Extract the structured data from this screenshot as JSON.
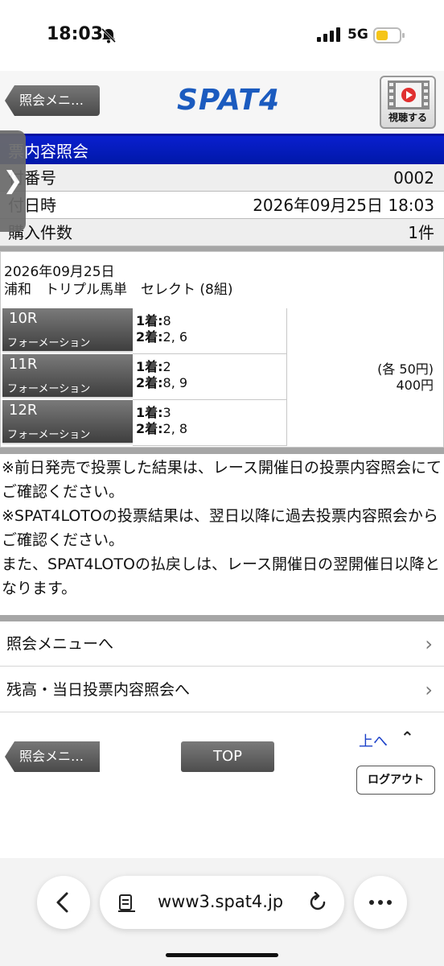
{
  "status": {
    "time": "18:03",
    "network": "5G"
  },
  "header": {
    "back_menu": "照会メニ…",
    "logo": "SPAT4",
    "watch_label": "視聴する"
  },
  "info": {
    "title": "票内容照会",
    "rows": [
      {
        "label": "付番号",
        "value": "0002"
      },
      {
        "label": "付日時",
        "value": "2026年09月25日  18:03"
      },
      {
        "label": "購入件数",
        "value": "1件"
      }
    ]
  },
  "bet": {
    "date": "2026年09月25日",
    "type": "浦和　トリプル馬単　セレクト (8組)",
    "races": [
      {
        "race": "10R",
        "method": "フォーメーション",
        "first_label": "1着:",
        "first": "8",
        "second_label": "2着:",
        "second": "2, 6"
      },
      {
        "race": "11R",
        "method": "フォーメーション",
        "first_label": "1着:",
        "first": "2",
        "second_label": "2着:",
        "second": "8, 9"
      },
      {
        "race": "12R",
        "method": "フォーメーション",
        "first_label": "1着:",
        "first": "3",
        "second_label": "2着:",
        "second": "2, 8"
      }
    ],
    "unit_price": "(各 50円)",
    "total": "400円"
  },
  "notes": [
    "※前日発売で投票した結果は、レース開催日の投票内容照会にてご確認ください。",
    "※SPAT4LOTOの投票結果は、翌日以降に過去投票内容照会からご確認ください。",
    "また、SPAT4LOTOの払戻しは、レース開催日の翌開催日以降となります。"
  ],
  "links": [
    {
      "label": "照会メニューへ"
    },
    {
      "label": "残高・当日投票内容照会へ"
    }
  ],
  "footer": {
    "back_menu": "照会メニ…",
    "top": "TOP",
    "to_top": "上へ",
    "logout": "ログアウト"
  },
  "browser": {
    "url": "www3.spat4.jp"
  }
}
